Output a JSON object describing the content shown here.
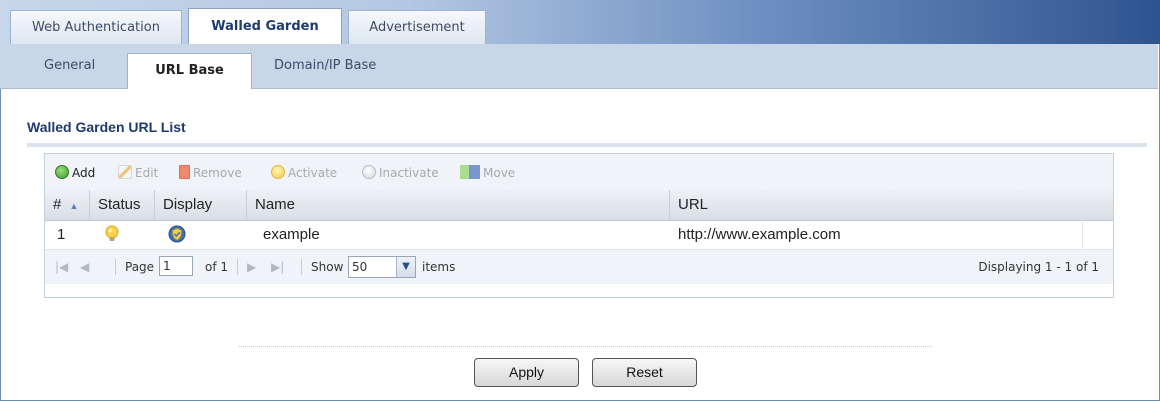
{
  "top_tabs": [
    {
      "label": "Web Authentication"
    },
    {
      "label": "Walled Garden"
    },
    {
      "label": "Advertisement"
    }
  ],
  "sub_tabs": [
    {
      "label": "General"
    },
    {
      "label": "URL Base"
    },
    {
      "label": "Domain/IP Base"
    }
  ],
  "section": {
    "title": "Walled Garden URL List"
  },
  "toolbar": {
    "add": "Add",
    "edit": "Edit",
    "remove": "Remove",
    "activate": "Activate",
    "inactivate": "Inactivate",
    "move": "Move"
  },
  "table": {
    "columns": [
      "#",
      "Status",
      "Display",
      "Name",
      "URL"
    ],
    "rows": [
      {
        "index": "1",
        "status_icon": "lightbulb-on-icon",
        "display_icon": "display-shield-icon",
        "name": "example",
        "url": "http://www.example.com"
      }
    ]
  },
  "pager": {
    "page_label": "Page",
    "page_value": "1",
    "of_label": "of 1",
    "show_label": "Show",
    "show_value": "50",
    "items_label": "items",
    "displaying": "Displaying 1 - 1 of 1"
  },
  "buttons": {
    "apply": "Apply",
    "reset": "Reset"
  },
  "colors": {
    "title": "#1f3a6e",
    "tab_bar_dark": "#2e5490"
  }
}
